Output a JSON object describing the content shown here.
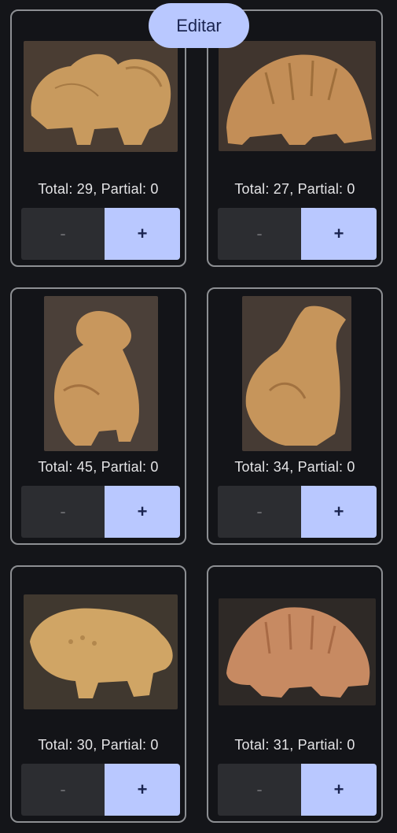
{
  "edit_label": "Editar",
  "cards": [
    {
      "counter": "Total: 29, Partial: 0",
      "minus": "-",
      "plus": "+"
    },
    {
      "counter": "Total: 27, Partial: 0",
      "minus": "-",
      "plus": "+"
    },
    {
      "counter": "Total: 45, Partial: 0",
      "minus": "-",
      "plus": "+"
    },
    {
      "counter": "Total: 34, Partial: 0",
      "minus": "-",
      "plus": "+"
    },
    {
      "counter": "Total: 30, Partial: 0",
      "minus": "-",
      "plus": "+"
    },
    {
      "counter": "Total: 31, Partial: 0",
      "minus": "-",
      "plus": "+"
    }
  ],
  "colors": {
    "background": "#141519",
    "accent": "#b9c8ff",
    "accent_text": "#1a2450",
    "card_border": "#8d8f93",
    "minus_bg": "#2c2d31"
  }
}
